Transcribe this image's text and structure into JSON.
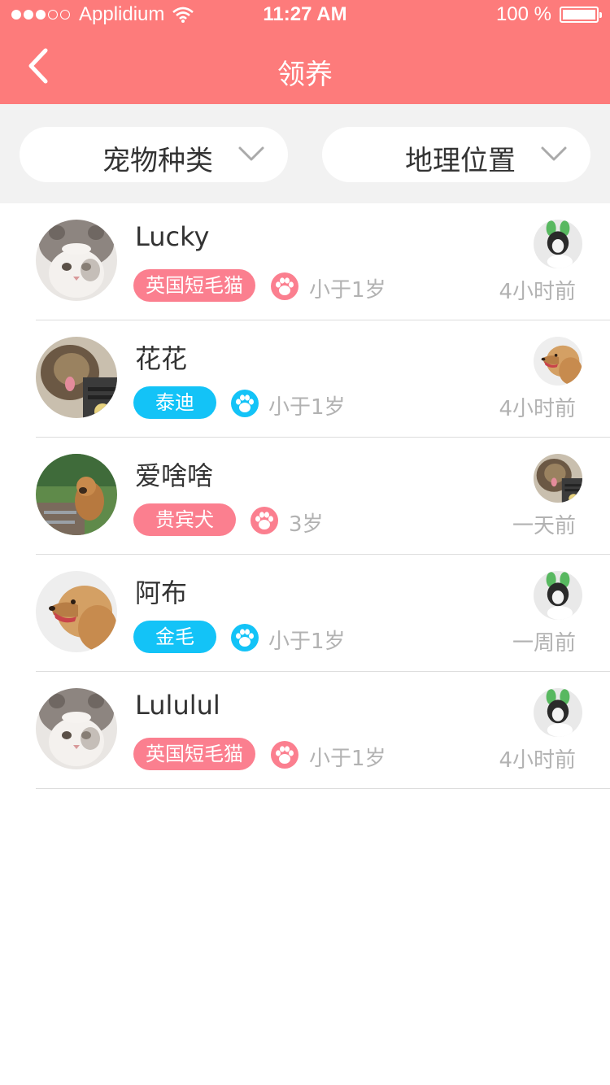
{
  "status_bar": {
    "signal_dots": [
      true,
      true,
      true,
      false,
      false
    ],
    "carrier": "Applidium",
    "wifi_icon": "wifi-icon",
    "time": "11:27 AM",
    "battery_text": "100 %",
    "battery_level": 1.0
  },
  "nav": {
    "title": "领养",
    "back_icon": "chevron-left-icon"
  },
  "filters": {
    "species_label": "宠物种类",
    "location_label": "地理位置",
    "chevron_icon": "chevron-down-icon"
  },
  "colors": {
    "header": "#fd7b7b",
    "tag_pink": "#fb7f8f",
    "tag_blue": "#13c3f7",
    "muted_text": "#b2b2b2"
  },
  "pets": [
    {
      "name": "Lucky",
      "breed": "英国短毛猫",
      "tag_color": "pink",
      "age": "小于1岁",
      "time": "4小时前",
      "avatar": "cat-in-hat-photo",
      "owner_avatar": "owner-bunny-ears-photo"
    },
    {
      "name": "花花",
      "breed": "泰迪",
      "tag_color": "blue",
      "age": "小于1岁",
      "time": "4小时前",
      "avatar": "yorkie-dog-photo",
      "owner_avatar": "owner-golden-retriever-photo"
    },
    {
      "name": "爱啥啥",
      "breed": "贵宾犬",
      "tag_color": "pink",
      "age": "3岁",
      "time": "一天前",
      "avatar": "brown-dog-garden-photo",
      "owner_avatar": "owner-yorkie-photo"
    },
    {
      "name": "阿布",
      "breed": "金毛",
      "tag_color": "blue",
      "age": "小于1岁",
      "time": "一周前",
      "avatar": "golden-retriever-photo",
      "owner_avatar": "owner-bunny-ears-photo"
    },
    {
      "name": "Lululul",
      "breed": "英国短毛猫",
      "tag_color": "pink",
      "age": "小于1岁",
      "time": "4小时前",
      "avatar": "cat-in-hat-photo",
      "owner_avatar": "owner-bunny-ears-photo"
    }
  ]
}
